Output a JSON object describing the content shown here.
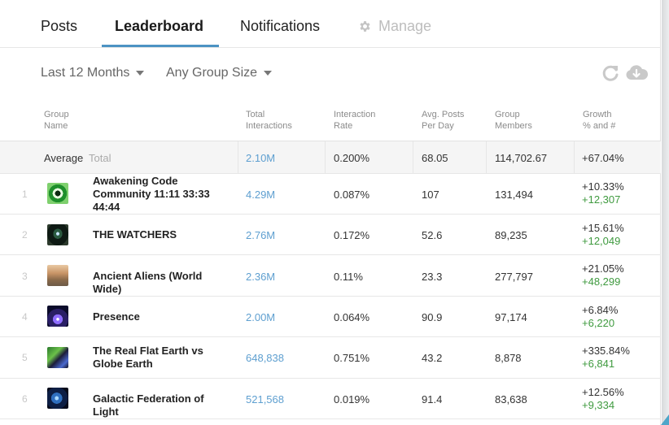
{
  "tabs": {
    "posts": "Posts",
    "leaderboard": "Leaderboard",
    "notifications": "Notifications",
    "manage": "Manage"
  },
  "filters": {
    "period": "Last 12 Months",
    "group_size": "Any Group Size"
  },
  "columns": {
    "name": [
      "Group",
      "Name"
    ],
    "interactions": [
      "Total",
      "Interactions"
    ],
    "rate": [
      "Interaction",
      "Rate"
    ],
    "posts": [
      "Avg. Posts",
      "Per Day"
    ],
    "members": [
      "Group",
      "Members"
    ],
    "growth": [
      "Growth",
      "% and #"
    ]
  },
  "average": {
    "label": "Average",
    "sublabel": "Total",
    "interactions": "2.10M",
    "rate": "0.200%",
    "posts": "68.05",
    "members": "114,702.67",
    "growth": "+67.04%"
  },
  "rows": [
    {
      "rank": "1",
      "name": "Awakening Code Community 11:11 33:33 44:44",
      "interactions": "4.29M",
      "rate": "0.087%",
      "posts": "107",
      "members": "131,494",
      "growth_pct": "+10.33%",
      "growth_num": "+12,307"
    },
    {
      "rank": "2",
      "name": "THE WATCHERS",
      "interactions": "2.76M",
      "rate": "0.172%",
      "posts": "52.6",
      "members": "89,235",
      "growth_pct": "+15.61%",
      "growth_num": "+12,049"
    },
    {
      "rank": "3",
      "name": "Ancient Aliens (World Wide)",
      "interactions": "2.36M",
      "rate": "0.11%",
      "posts": "23.3",
      "members": "277,797",
      "growth_pct": "+21.05%",
      "growth_num": "+48,299"
    },
    {
      "rank": "4",
      "name": "Presence",
      "interactions": "2.00M",
      "rate": "0.064%",
      "posts": "90.9",
      "members": "97,174",
      "growth_pct": "+6.84%",
      "growth_num": "+6,220"
    },
    {
      "rank": "5",
      "name": "The Real Flat Earth vs Globe Earth",
      "interactions": "648,838",
      "rate": "0.751%",
      "posts": "43.2",
      "members": "8,878",
      "growth_pct": "+335.84%",
      "growth_num": "+6,841"
    },
    {
      "rank": "6",
      "name": "Galactic Federation of Light",
      "interactions": "521,568",
      "rate": "0.019%",
      "posts": "91.4",
      "members": "83,638",
      "growth_pct": "+12.56%",
      "growth_num": "+9,334"
    }
  ],
  "colors": {
    "accent": "#4c93c3",
    "link": "#5e9fd0",
    "growth_positive": "#3f9a3f"
  },
  "icons": {
    "manage": "gear-icon",
    "refresh": "refresh-icon",
    "download": "cloud-download-icon"
  }
}
